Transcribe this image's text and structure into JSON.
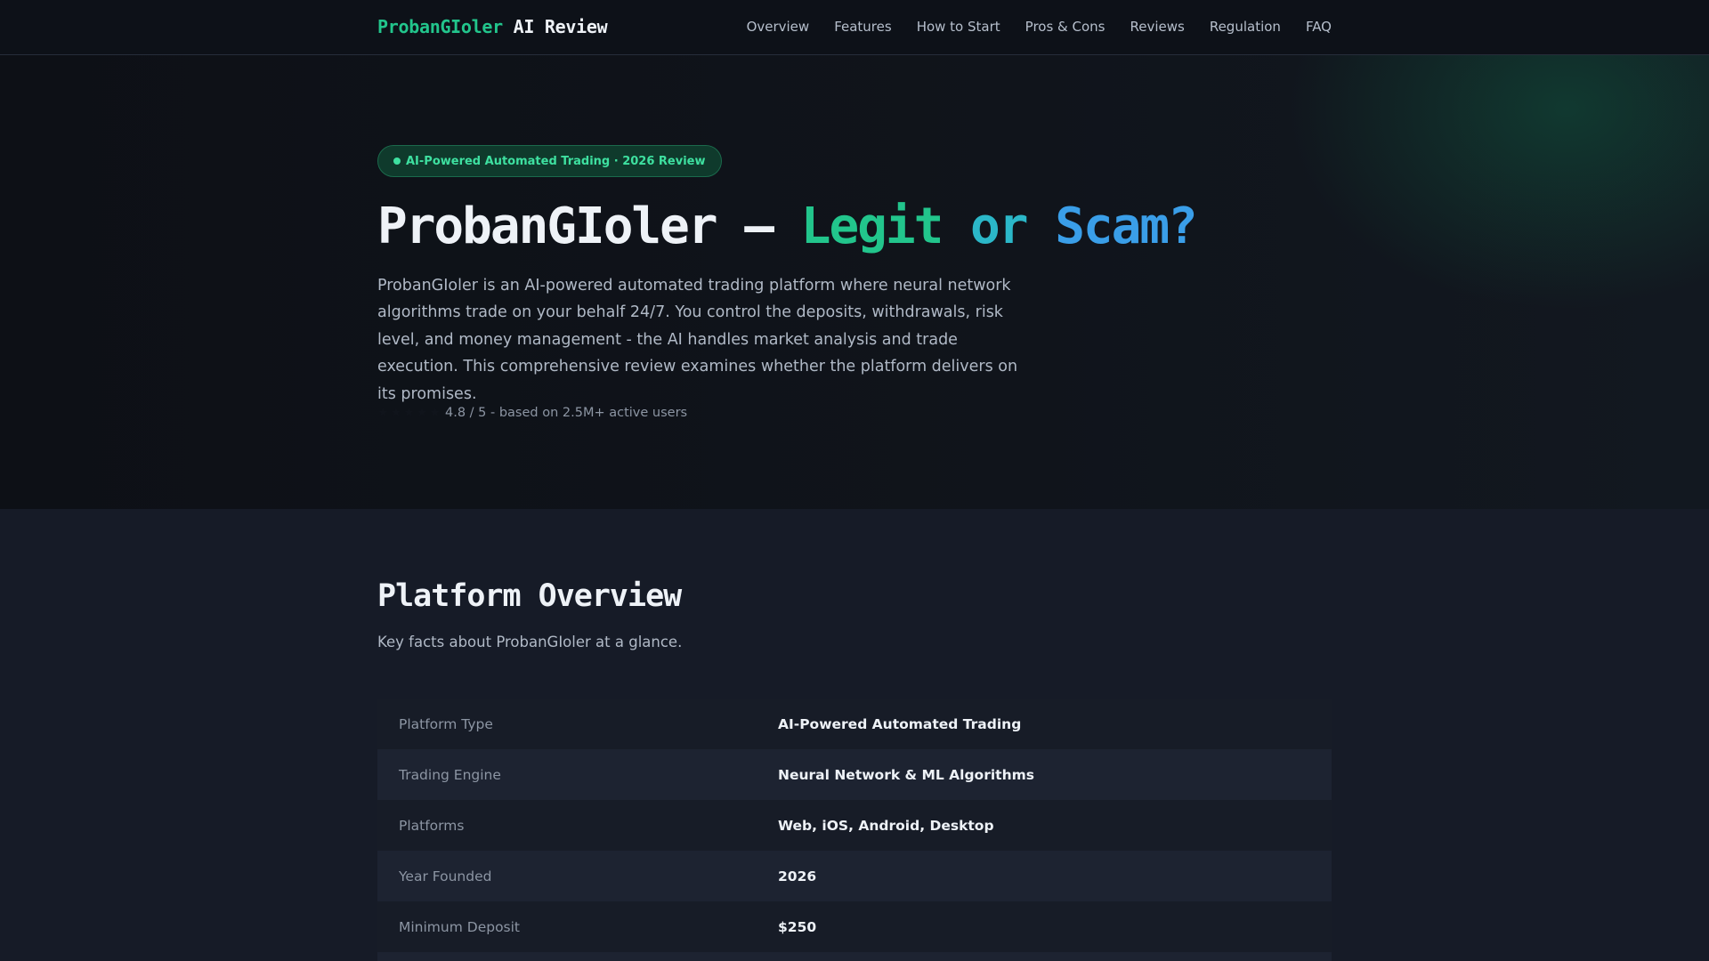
{
  "brand": {
    "name": "ProbanGIoler",
    "suffix": "AI Review"
  },
  "nav": {
    "items": [
      "Overview",
      "Features",
      "How to Start",
      "Pros & Cons",
      "Reviews",
      "Regulation",
      "FAQ"
    ]
  },
  "hero": {
    "badge": "AI-Powered Automated Trading · 2026 Review",
    "title_main": "ProbanGIoler –",
    "title_legit": "Legit",
    "title_or": "or",
    "title_scam": "Scam?",
    "description": "ProbanGIoler is an AI-powered automated trading platform where neural network algorithms trade on your behalf 24/7. You control the deposits, withdrawals, risk level, and money management - the AI handles market analysis and trade execution. This comprehensive review examines whether the platform delivers on its promises.",
    "rating_text": "4.8 / 5 - based on 2.5M+ active users",
    "rating_value": 4.8,
    "rating_max": 5
  },
  "overview": {
    "title": "Platform Overview",
    "subtitle": "Key facts about ProbanGIoler at a glance.",
    "rows": [
      {
        "label": "Platform Type",
        "value": "AI-Powered Automated Trading"
      },
      {
        "label": "Trading Engine",
        "value": "Neural Network & ML Algorithms"
      },
      {
        "label": "Platforms",
        "value": "Web, iOS, Android, Desktop"
      },
      {
        "label": "Year Founded",
        "value": "2026"
      },
      {
        "label": "Minimum Deposit",
        "value": "$250"
      }
    ]
  },
  "colors": {
    "accent_green": "#22c58c",
    "accent_teal": "#2bb7c8",
    "accent_blue": "#3a9ee8",
    "background": "#161b27"
  }
}
